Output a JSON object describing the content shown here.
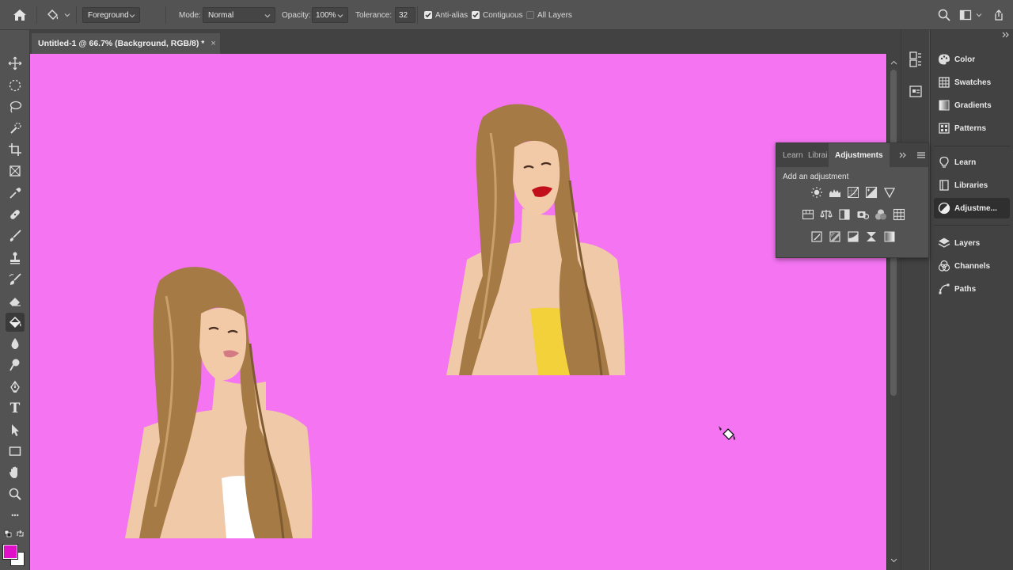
{
  "options_bar": {
    "fill_source": "Foreground",
    "mode_label": "Mode:",
    "mode_value": "Normal",
    "opacity_label": "Opacity:",
    "opacity_value": "100%",
    "tolerance_label": "Tolerance:",
    "tolerance_value": "32",
    "anti_alias_label": "Anti-alias",
    "anti_alias_checked": true,
    "contiguous_label": "Contiguous",
    "contiguous_checked": true,
    "all_layers_label": "All Layers",
    "all_layers_checked": false
  },
  "document": {
    "tab_title": "Untitled-1 @ 66.7% (Background, RGB/8) *",
    "close_glyph": "×",
    "canvas_color": "#f474f2"
  },
  "tools": [
    "move-icon",
    "marquee-icon",
    "lasso-icon",
    "quick-selection-icon",
    "crop-icon",
    "frame-icon",
    "eyedropper-icon",
    "healing-brush-icon",
    "brush-icon",
    "clone-stamp-icon",
    "history-brush-icon",
    "eraser-icon",
    "paint-bucket-icon",
    "blur-icon",
    "dodge-icon",
    "pen-icon",
    "type-icon",
    "path-selection-icon",
    "rectangle-icon",
    "hand-icon",
    "zoom-icon",
    "more-tools-icon"
  ],
  "colors": {
    "foreground": "#e010c8",
    "background": "#ffffff"
  },
  "right_panels": {
    "group1": [
      "Color",
      "Swatches",
      "Gradients",
      "Patterns"
    ],
    "group2": [
      "Learn",
      "Libraries",
      "Adjustme..."
    ],
    "group3": [
      "Layers",
      "Channels",
      "Paths"
    ]
  },
  "adjustments_panel": {
    "tab_learn": "Learn",
    "tab_libraries": "Librai",
    "tab_adjustments": "Adjustments",
    "subtitle": "Add an adjustment"
  },
  "type_tool_glyph": "T",
  "more_glyph": "•••"
}
